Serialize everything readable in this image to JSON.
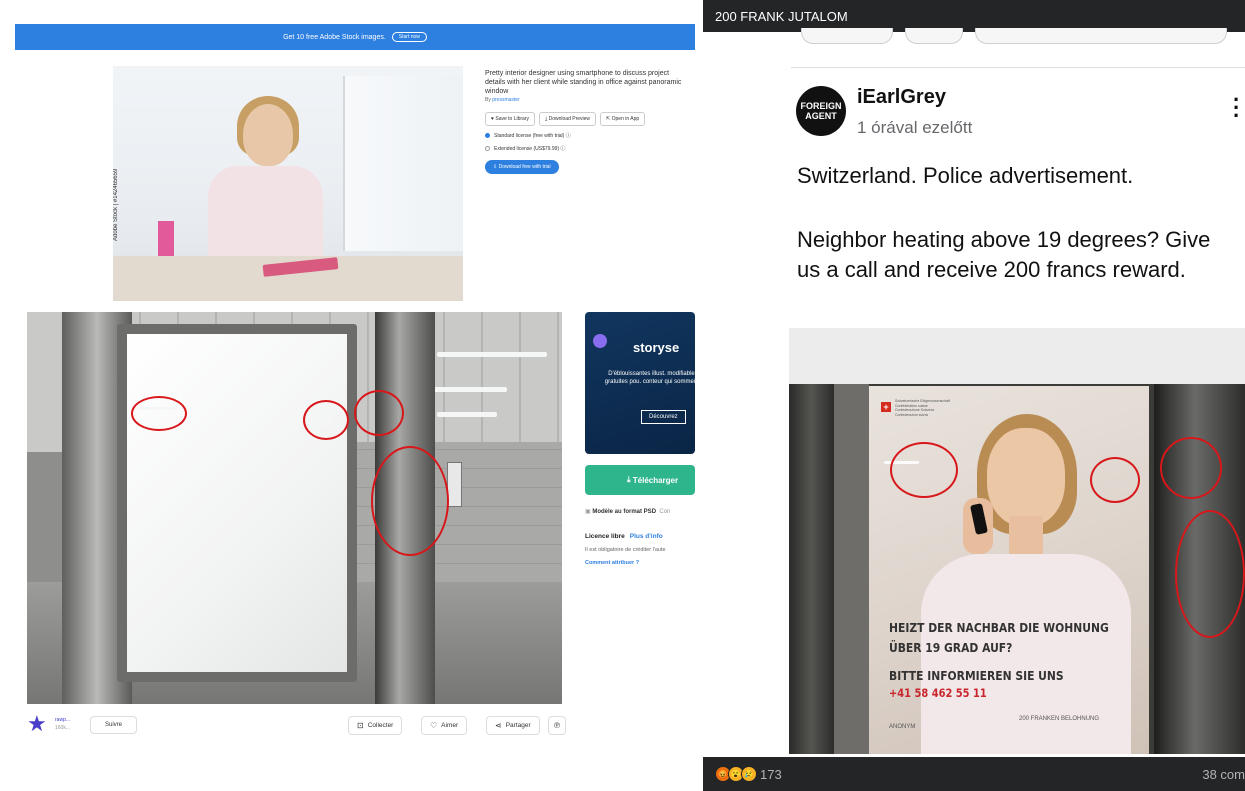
{
  "adobe_stock": {
    "banner_text": "Get 10 free Adobe Stock images.",
    "banner_button": "Start now",
    "image_title": "Pretty interior designer using smartphone to discuss project details with her client while standing in office against panoramic window",
    "by_label": "By",
    "author": "pressmaster",
    "watermark": "Adobe Stock | #142465659",
    "buttons": [
      "Save to Library",
      "Download Preview",
      "Open in App"
    ],
    "licenses": [
      {
        "label": "Standard license (free with trial) ⓘ",
        "selected": true
      },
      {
        "label": "Extended license (US$79.99) ⓘ",
        "selected": false
      }
    ],
    "download_button": "Download free with trial"
  },
  "rawpixel": {
    "promo": {
      "brand": "storyse",
      "text": "D'éblouissantes illust. modifiables gratuites pou. conteur qui sommeille",
      "button": "Découvrez"
    },
    "download_button": "Télécharger",
    "format_label": "Modèle au format PSD",
    "format_extra": "Con",
    "license_title": "Licence libre",
    "license_more": "Plus d'info",
    "license_note": "Il est obligatoire de créditer l'aute",
    "attribution_link": "Comment attribuer ?",
    "author_short": "rawp...",
    "author_sub": "160k...",
    "follow": "Suivre",
    "actions": [
      {
        "icon": "collect-icon",
        "glyph": "⊡",
        "label": "Collecter"
      },
      {
        "icon": "heart-icon",
        "glyph": "♡",
        "label": "Aimer"
      },
      {
        "icon": "share-icon",
        "glyph": "⋖",
        "label": "Partager"
      }
    ],
    "pinterest_glyph": "℗"
  },
  "facebook": {
    "top_bar_title": "200 FRANK JUTALOM",
    "avatar_text_1": "FOREIGN",
    "avatar_text_2": "AGENT",
    "poster_name": "iEarlGrey",
    "time": "1 órával ezelőtt",
    "post_line_1": "Switzerland. Police advertisement.",
    "post_line_2": "Neighbor heating above 19 degrees? Give us a call and receive 200 francs reward.",
    "poster": {
      "confed_lines": [
        "Schweizerische Eidgenossenschaft",
        "Confédération suisse",
        "Confederazione Svizzera",
        "Confederaziun svizra"
      ],
      "headline_1": "HEIZT DER NACHBAR DIE WOHNUNG",
      "headline_2": "ÜBER 19 GRAD AUF?",
      "headline_3": "BITTE INFORMIEREN SIE UNS",
      "phone": "+41 58 462 55 11",
      "anon": "ANONYM",
      "reward": "200 FRANKEN BELOHNUNG"
    },
    "reaction_count": "173",
    "comments": "38 com"
  },
  "colors": {
    "adobe_blue": "#2d7fe0",
    "rawpixel_green": "#2fb58c",
    "markup_red": "#d8171a",
    "fb_dark": "#242526"
  }
}
